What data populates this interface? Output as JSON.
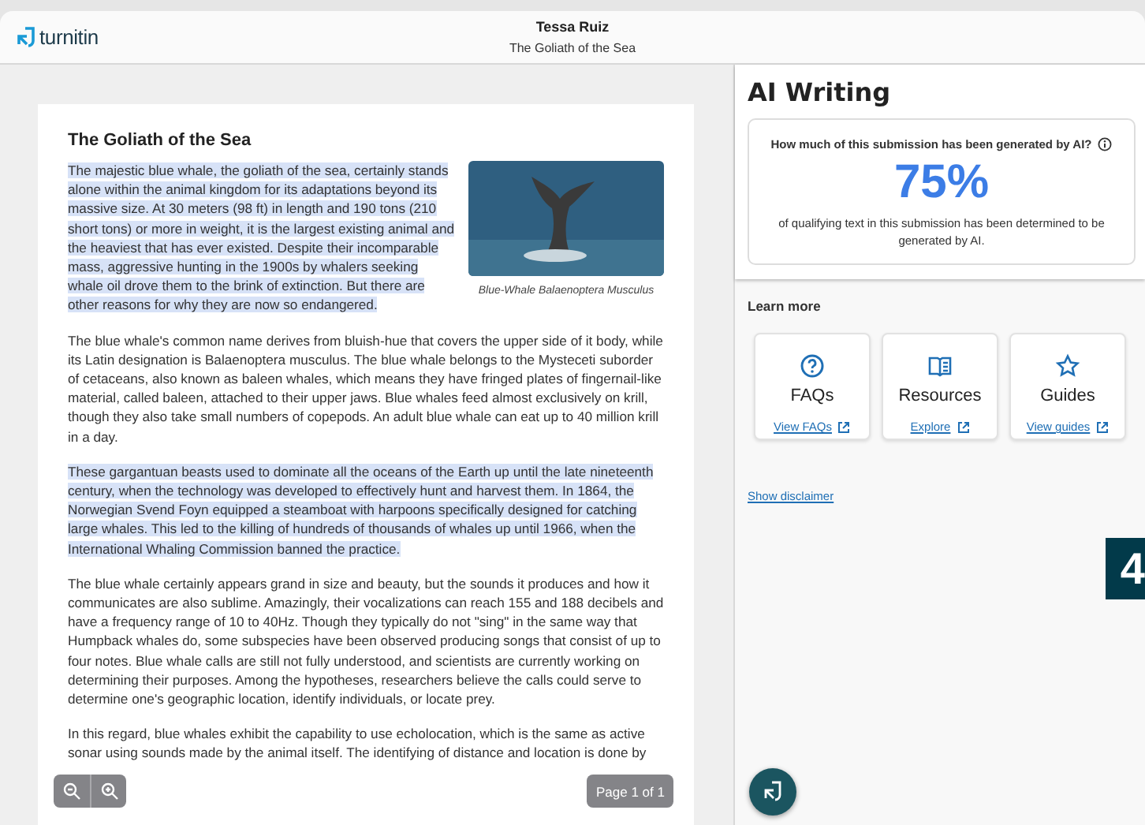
{
  "header": {
    "logo": "turnitin",
    "author": "Tessa Ruiz",
    "title": "The Goliath of the Sea"
  },
  "document": {
    "heading": "The Goliath of the Sea",
    "image_caption": "Blue-Whale Balaenoptera Musculus",
    "paragraphs": [
      {
        "text": "The majestic blue whale, the goliath of the sea, certainly stands alone within the animal kingdom for its adaptations beyond its massive size. At 30 meters (98 ft) in length and 190 tons (210 short tons) or more in weight, it is the largest existing animal and the heaviest that has ever existed. Despite their incomparable mass, aggressive hunting in the 1900s by whalers seeking whale oil drove them to the brink of extinction. But there are other reasons for why they are now so endangered.",
        "highlighted": true
      },
      {
        "text": "The blue whale's common name derives from bluish-hue that covers the upper side of it body, while its Latin designation is Balaenoptera musculus. The blue whale belongs to the Mysteceti suborder of cetaceans, also known as baleen whales, which means they have fringed plates of fingernail-like material, called baleen, attached to their upper jaws. Blue whales feed almost exclusively on krill, though they also take small numbers of copepods. An adult blue whale can eat up to 40 million krill in a day.",
        "highlighted": false
      },
      {
        "text": "These gargantuan beasts used to dominate all the oceans of the Earth up until the late nineteenth century, when the technology was developed to effectively hunt and harvest them. In 1864, the Norwegian Svend Foyn equipped a steamboat with harpoons specifically designed for catching large whales. This led to the killing of hundreds of thousands of whales up until 1966, when the International Whaling Commission banned the practice.",
        "highlighted": true
      },
      {
        "text": "The blue whale certainly appears grand in size and beauty, but the sounds it produces and how it communicates are also sublime. Amazingly, their vocalizations can reach 155 and 188 decibels and have a frequency range of 10 to 40Hz. Though they typically do not \"sing\" in the same way that Humpback whales do, some subspecies have been observed producing songs that consist of up to four notes. Blue whale calls are still not fully understood, and scientists are currently working on determining their purposes. Among the hypotheses, researchers believe the calls could serve to determine one's geographic location, identify individuals, or locate prey.",
        "highlighted": false
      },
      {
        "text": "In this regard, blue whales exhibit the capability to use echolocation, which is the same as active sonar using sounds made by the animal itself. The identifying of distance and location is done by",
        "highlighted": false
      }
    ]
  },
  "viewer_controls": {
    "page_indicator": "Page 1 of 1"
  },
  "ai_panel": {
    "title": "AI Writing",
    "question": "How much of this submission has been generated by AI?",
    "score": "75%",
    "description": "of qualifying text in this submission has been determined to be generated by AI.",
    "learn_more": "Learn more",
    "resources": [
      {
        "kind": "question",
        "title": "FAQs",
        "link": "View FAQs"
      },
      {
        "kind": "book",
        "title": "Resources",
        "link": "Explore"
      },
      {
        "kind": "star",
        "title": "Guides",
        "link": "View guides"
      }
    ],
    "disclaimer_link": "Show disclaimer"
  },
  "step_badge": "4"
}
